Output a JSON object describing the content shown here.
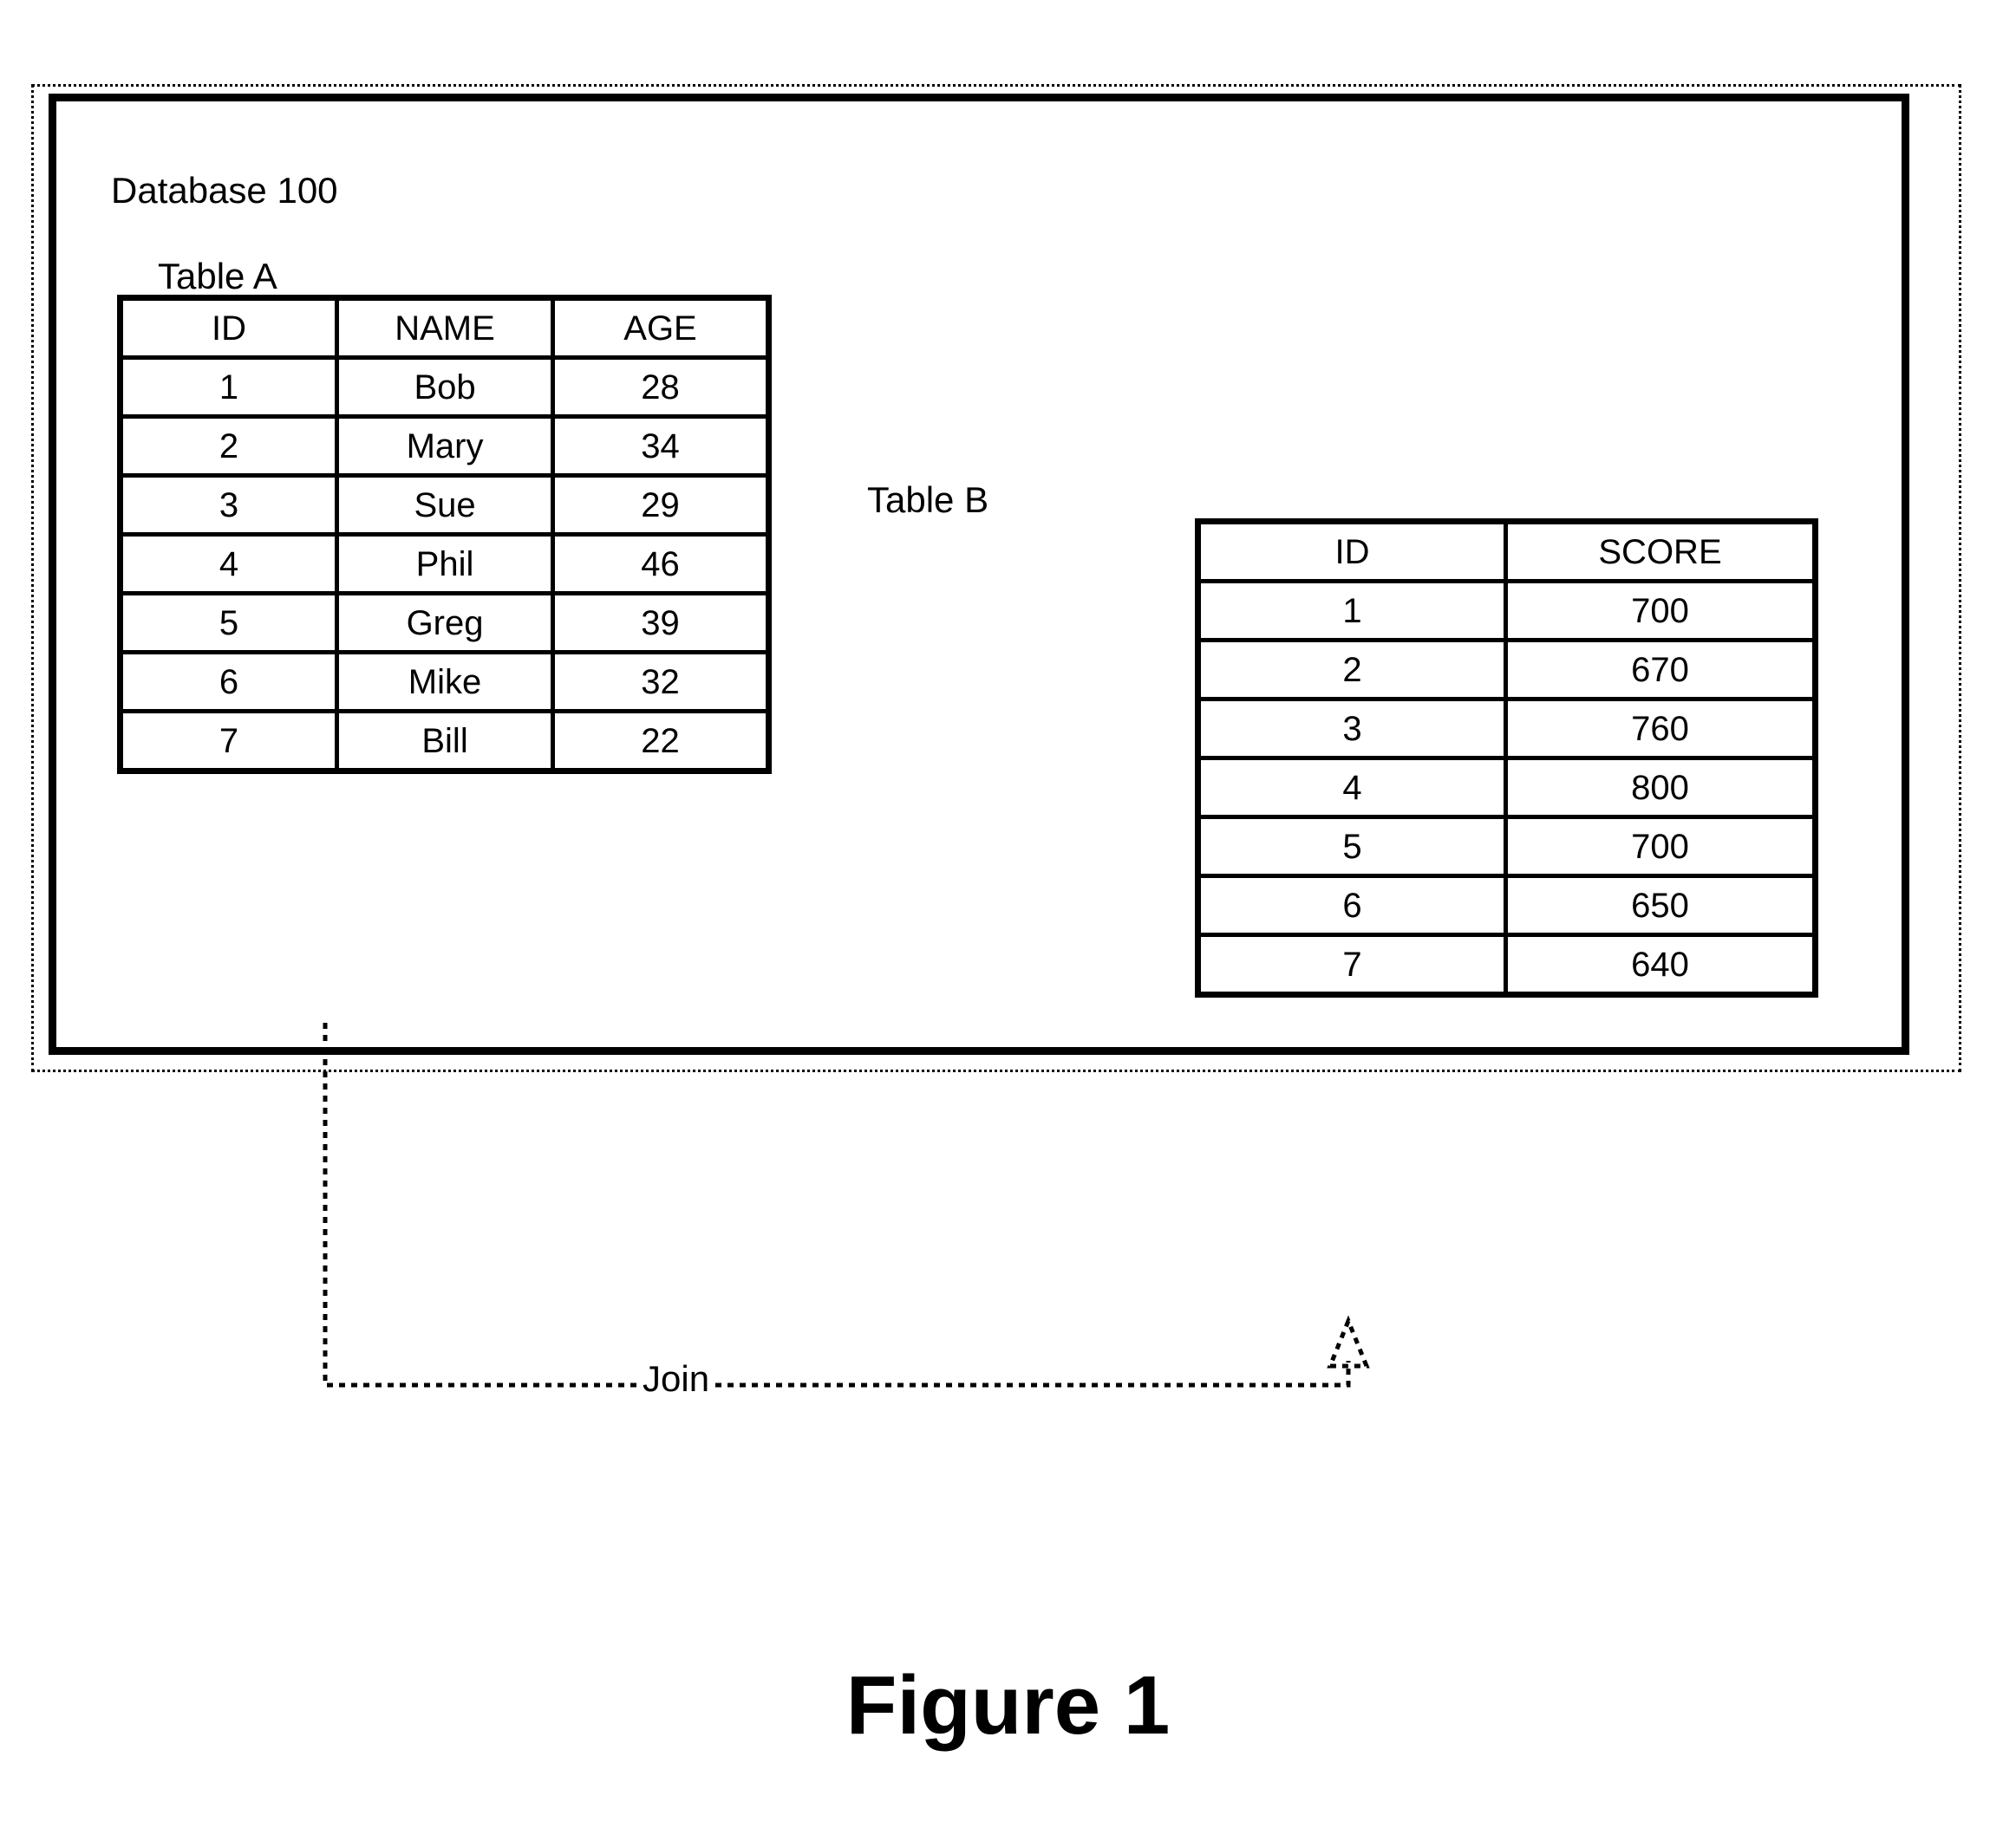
{
  "figure": {
    "caption": "Figure 1"
  },
  "database": {
    "label": "Database 100"
  },
  "table_a": {
    "caption": "Table A",
    "headers": [
      "ID",
      "NAME",
      "AGE"
    ],
    "rows": [
      [
        "1",
        "Bob",
        "28"
      ],
      [
        "2",
        "Mary",
        "34"
      ],
      [
        "3",
        "Sue",
        "29"
      ],
      [
        "4",
        "Phil",
        "46"
      ],
      [
        "5",
        "Greg",
        "39"
      ],
      [
        "6",
        "Mike",
        "32"
      ],
      [
        "7",
        "Bill",
        "22"
      ]
    ]
  },
  "table_b": {
    "caption": "Table B",
    "headers": [
      "ID",
      "SCORE"
    ],
    "rows": [
      [
        "1",
        "700"
      ],
      [
        "2",
        "670"
      ],
      [
        "3",
        "760"
      ],
      [
        "4",
        "800"
      ],
      [
        "5",
        "700"
      ],
      [
        "6",
        "650"
      ],
      [
        "7",
        "640"
      ]
    ]
  },
  "join": {
    "label": "Join"
  },
  "colors": {
    "ink": "#000000",
    "paper": "#ffffff"
  }
}
